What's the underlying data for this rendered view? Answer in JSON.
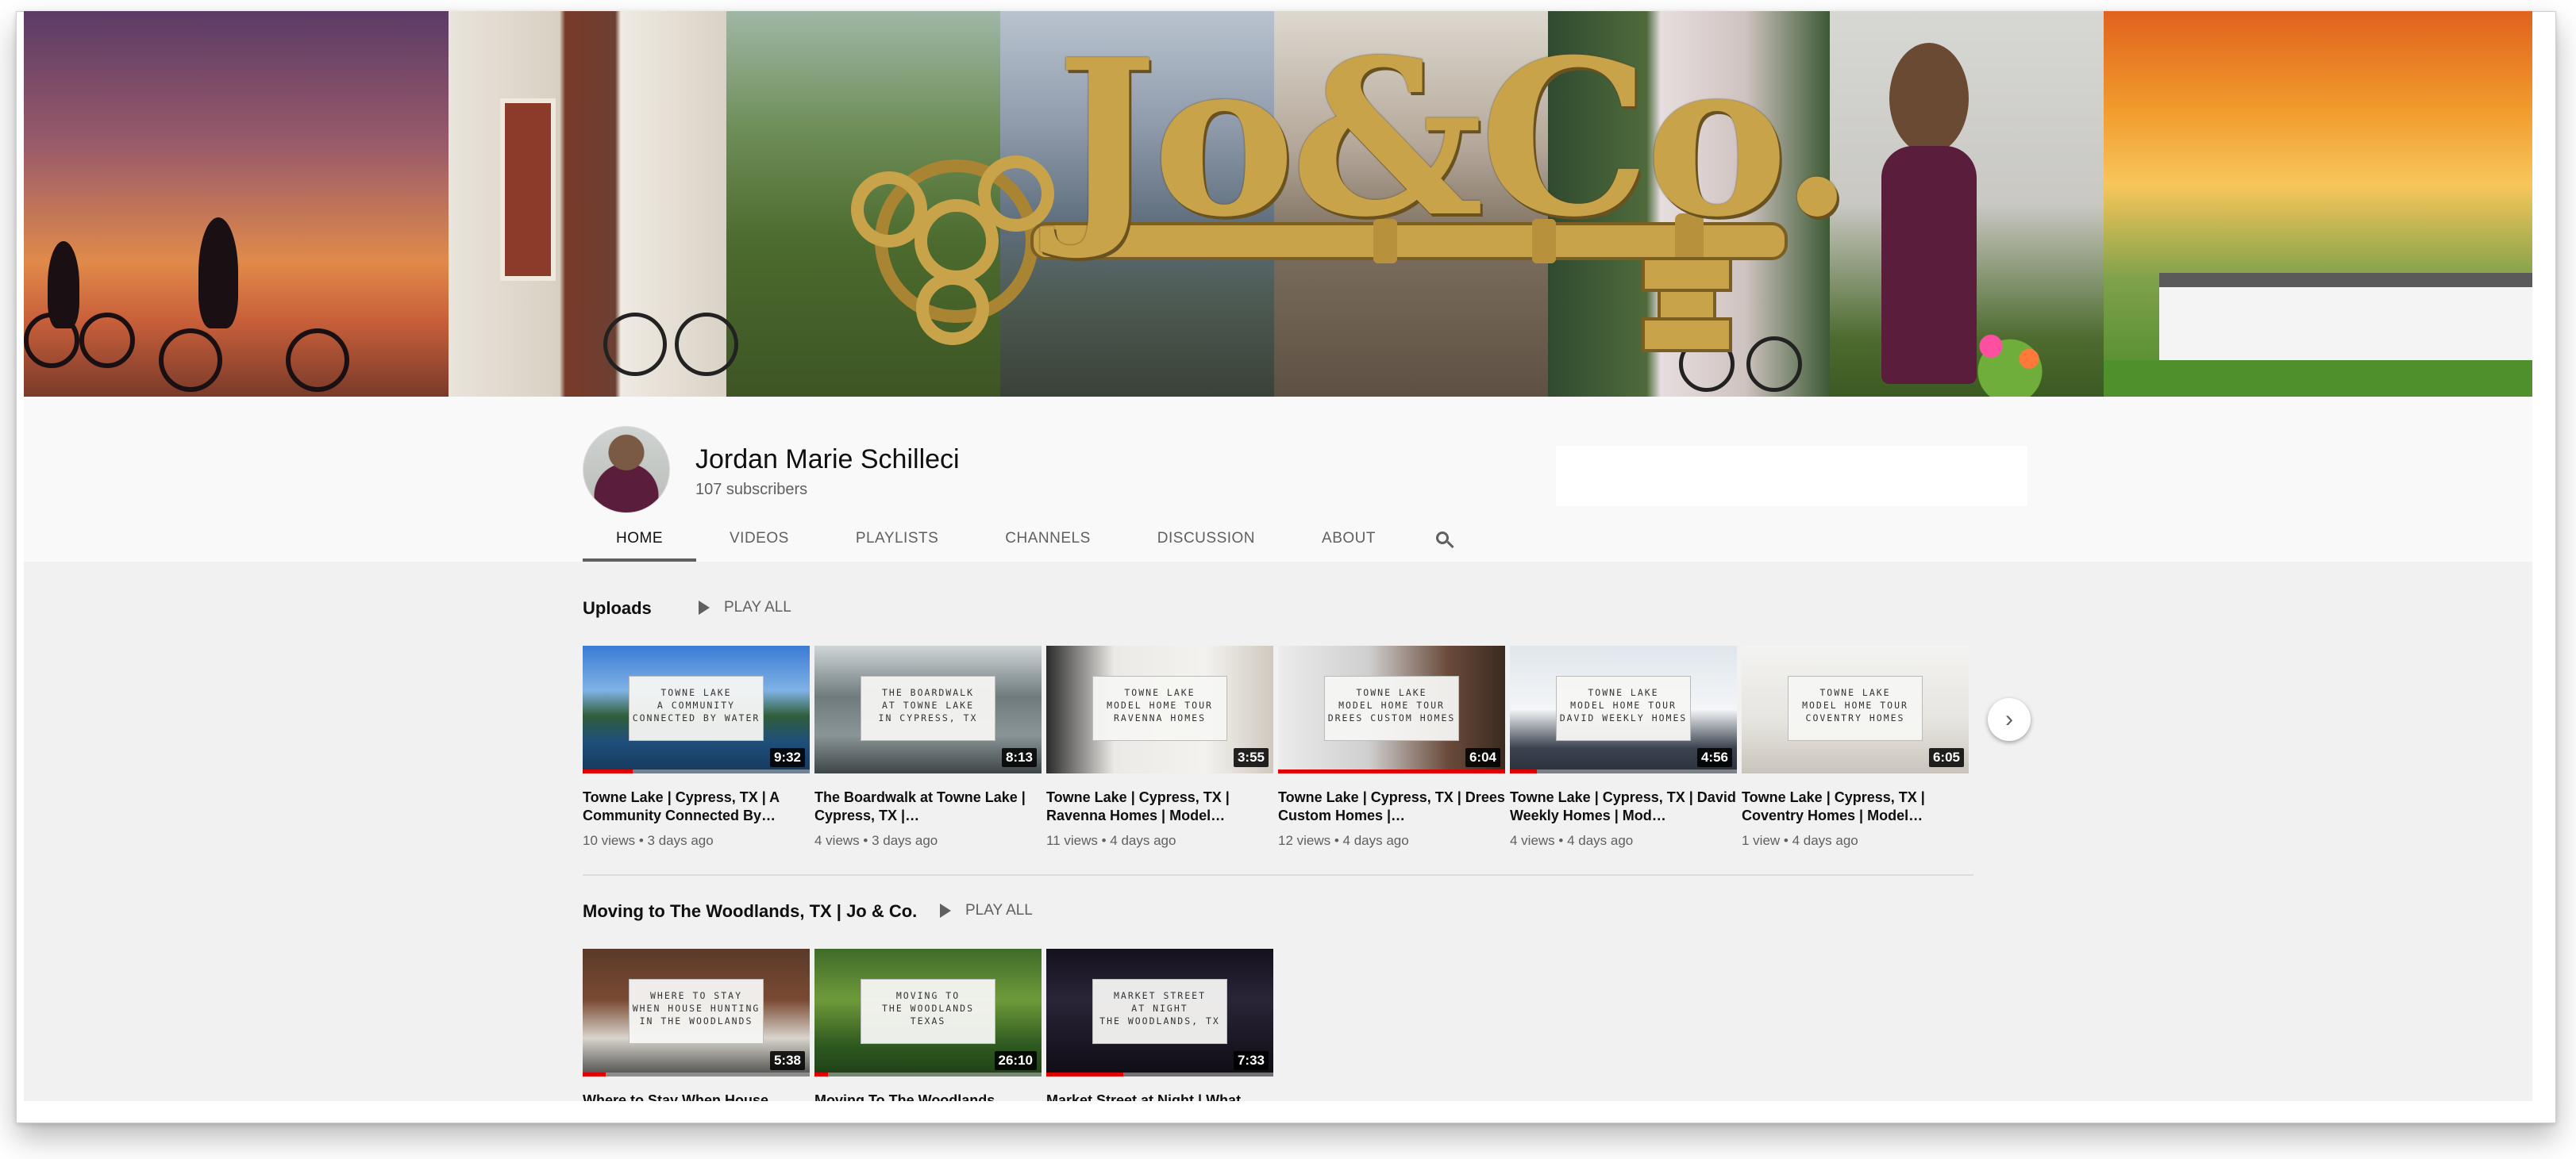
{
  "banner": {
    "logo_text": "Jo&Co."
  },
  "channel": {
    "name": "Jordan Marie Schilleci",
    "subscribers": "107 subscribers"
  },
  "tabs": [
    {
      "label": "HOME",
      "active": true
    },
    {
      "label": "VIDEOS",
      "active": false
    },
    {
      "label": "PLAYLISTS",
      "active": false
    },
    {
      "label": "CHANNELS",
      "active": false
    },
    {
      "label": "DISCUSSION",
      "active": false
    },
    {
      "label": "ABOUT",
      "active": false
    }
  ],
  "search_icon": "search-icon",
  "shelves": [
    {
      "title": "Uploads",
      "play_all": "PLAY ALL",
      "videos": [
        {
          "card": "TOWNE LAKE\nA COMMUNITY\nCONNECTED BY WATER",
          "duration": "9:32",
          "title": "Towne Lake | Cypress, TX | A Community Connected By…",
          "meta": "10 views • 3 days ago",
          "progress": 0.22,
          "theme": "lake"
        },
        {
          "card": "THE BOARDWALK\nAT TOWNE LAKE\nIN CYPRESS, TX",
          "duration": "8:13",
          "title": "The Boardwalk at Towne Lake | Cypress, TX |…",
          "meta": "4 views • 3 days ago",
          "progress": 0,
          "theme": "boardwalk"
        },
        {
          "card": "TOWNE LAKE\nMODEL HOME TOUR\nRAVENNA HOMES",
          "duration": "3:55",
          "title": "Towne Lake | Cypress, TX | Ravenna Homes | Model…",
          "meta": "11 views • 4 days ago",
          "progress": 0,
          "theme": "kitchen"
        },
        {
          "card": "TOWNE LAKE\nMODEL HOME TOUR\nDREES CUSTOM HOMES",
          "duration": "6:04",
          "title": "Towne Lake | Cypress, TX | Drees Custom Homes |…",
          "meta": "12 views • 4 days ago",
          "progress": 1.0,
          "theme": "drees"
        },
        {
          "card": "TOWNE LAKE\nMODEL HOME TOUR\nDAVID WEEKLY HOMES",
          "duration": "4:56",
          "title": "Towne Lake | Cypress, TX | David Weekly Homes | Mod…",
          "meta": "4 views • 4 days ago",
          "progress": 0.12,
          "theme": "bedroom"
        },
        {
          "card": "TOWNE LAKE\nMODEL HOME TOUR\nCOVENTRY HOMES",
          "duration": "6:05",
          "title": "Towne Lake | Cypress, TX | Coventry Homes | Model…",
          "meta": "1 view • 4 days ago",
          "progress": 0,
          "theme": "coventry"
        }
      ]
    },
    {
      "title": "Moving to The Woodlands, TX | Jo & Co.",
      "play_all": "PLAY ALL",
      "videos": [
        {
          "card": "WHERE TO STAY\nWHEN HOUSE HUNTING\nIN THE WOODLANDS",
          "duration": "5:38",
          "title": "Where to Stay When House",
          "meta": "",
          "progress": 0.1,
          "theme": "hotel"
        },
        {
          "card": "MOVING TO\nTHE WOODLANDS\nTEXAS",
          "duration": "26:10",
          "title": "Moving To The Woodlands,",
          "meta": "",
          "progress": 0.06,
          "theme": "woodlands"
        },
        {
          "card": "MARKET STREET\nAT NIGHT\nTHE WOODLANDS, TX",
          "duration": "7:33",
          "title": "Market Street at Night | What",
          "meta": "",
          "progress": 0.34,
          "theme": "night"
        }
      ]
    }
  ],
  "next_button_icon": "chevron-right-icon",
  "colors": {
    "accent": "#e00000",
    "logo_gold": "#c9a34a",
    "page_bg": "#f1f1f1"
  }
}
